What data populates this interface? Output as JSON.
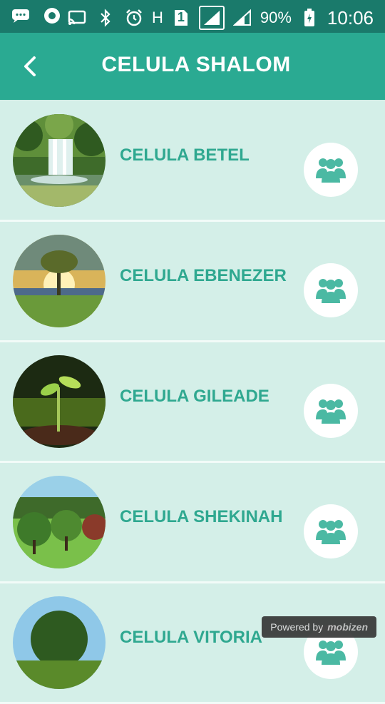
{
  "status_bar": {
    "battery_percent": "90%",
    "time": "10:06",
    "network_label": "H",
    "sim_number": "1"
  },
  "app_bar": {
    "title": "CELULA SHALOM"
  },
  "cells": [
    {
      "label": "CELULA BETEL",
      "image": "waterfall-photo"
    },
    {
      "label": "CELULA EBENEZER",
      "image": "tree-sunset-photo"
    },
    {
      "label": "CELULA GILEADE",
      "image": "sprout-photo"
    },
    {
      "label": "CELULA SHEKINAH",
      "image": "park-trees-photo"
    },
    {
      "label": "CELULA VITORIA",
      "image": "tree-photo"
    }
  ],
  "watermark": {
    "prefix": "Powered by",
    "brand": "mobizen"
  },
  "colors": {
    "status_bar": "#1a7a6b",
    "app_bar": "#2aaa92",
    "list_bg": "#d4efe8",
    "label": "#2fa890",
    "icon": "#4bb9a3"
  }
}
